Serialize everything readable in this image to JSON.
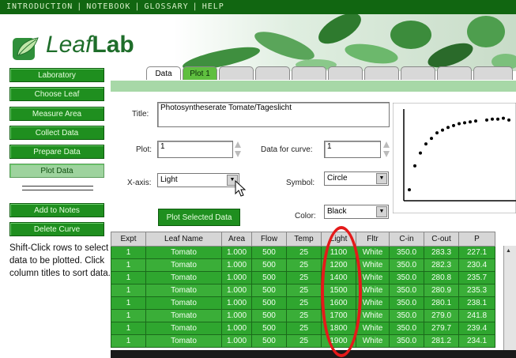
{
  "nav": {
    "items": [
      "INTRODUCTION",
      "NOTEBOOK",
      "GLOSSARY",
      "HELP"
    ]
  },
  "logo": {
    "text_italic": "Leaf",
    "text_bold": "Lab"
  },
  "sidebar": {
    "buttons": [
      "Laboratory",
      "Choose Leaf",
      "Measure Area",
      "Collect Data",
      "Prepare Data",
      "Plot Data"
    ],
    "lower_buttons": [
      "Add to Notes",
      "Delete Curve"
    ],
    "help_text": "Shift-Click rows to select data to be plotted. Click column titles to sort data."
  },
  "tabs": [
    "Data",
    "Plot 1"
  ],
  "form": {
    "title_label": "Title:",
    "title_value": "Photosyntheserate Tomate/Tageslicht",
    "plot_label": "Plot:",
    "plot_value": "1",
    "data_for_curve_label": "Data for curve:",
    "data_for_curve_value": "1",
    "xaxis_label": "X-axis:",
    "xaxis_value": "Light",
    "symbol_label": "Symbol:",
    "symbol_value": "Circle",
    "color_label": "Color:",
    "color_value": "Black",
    "plot_button": "Plot Selected Data"
  },
  "preview_chart": {
    "type": "scatter",
    "points": [
      [
        0.05,
        0.12
      ],
      [
        0.1,
        0.38
      ],
      [
        0.15,
        0.52
      ],
      [
        0.2,
        0.62
      ],
      [
        0.25,
        0.68
      ],
      [
        0.3,
        0.74
      ],
      [
        0.35,
        0.77
      ],
      [
        0.4,
        0.8
      ],
      [
        0.45,
        0.82
      ],
      [
        0.5,
        0.84
      ],
      [
        0.55,
        0.85
      ],
      [
        0.6,
        0.86
      ],
      [
        0.65,
        0.87
      ],
      [
        0.75,
        0.88
      ],
      [
        0.8,
        0.89
      ],
      [
        0.85,
        0.89
      ],
      [
        0.9,
        0.9
      ],
      [
        0.95,
        0.88
      ]
    ]
  },
  "table": {
    "columns": [
      "Expt",
      "Leaf Name",
      "Area",
      "Flow",
      "Temp",
      "Light",
      "Fltr",
      "C-in",
      "C-out",
      "P"
    ],
    "rows": [
      [
        "1",
        "Tomato",
        "1.000",
        "500",
        "25",
        "1100",
        "White",
        "350.0",
        "283.3",
        "227.1"
      ],
      [
        "1",
        "Tomato",
        "1.000",
        "500",
        "25",
        "1200",
        "White",
        "350.0",
        "282.3",
        "230.4"
      ],
      [
        "1",
        "Tomato",
        "1.000",
        "500",
        "25",
        "1400",
        "White",
        "350.0",
        "280.8",
        "235.7"
      ],
      [
        "1",
        "Tomato",
        "1.000",
        "500",
        "25",
        "1500",
        "White",
        "350.0",
        "280.9",
        "235.3"
      ],
      [
        "1",
        "Tomato",
        "1.000",
        "500",
        "25",
        "1600",
        "White",
        "350.0",
        "280.1",
        "238.1"
      ],
      [
        "1",
        "Tomato",
        "1.000",
        "500",
        "25",
        "1700",
        "White",
        "350.0",
        "279.0",
        "241.8"
      ],
      [
        "1",
        "Tomato",
        "1.000",
        "500",
        "25",
        "1800",
        "White",
        "350.0",
        "279.7",
        "239.4"
      ],
      [
        "1",
        "Tomato",
        "1.000",
        "500",
        "25",
        "1900",
        "White",
        "350.0",
        "281.2",
        "234.1"
      ]
    ]
  },
  "colors": {
    "accent": "#1f8f1f",
    "highlight_oval": "#e41a1a"
  }
}
